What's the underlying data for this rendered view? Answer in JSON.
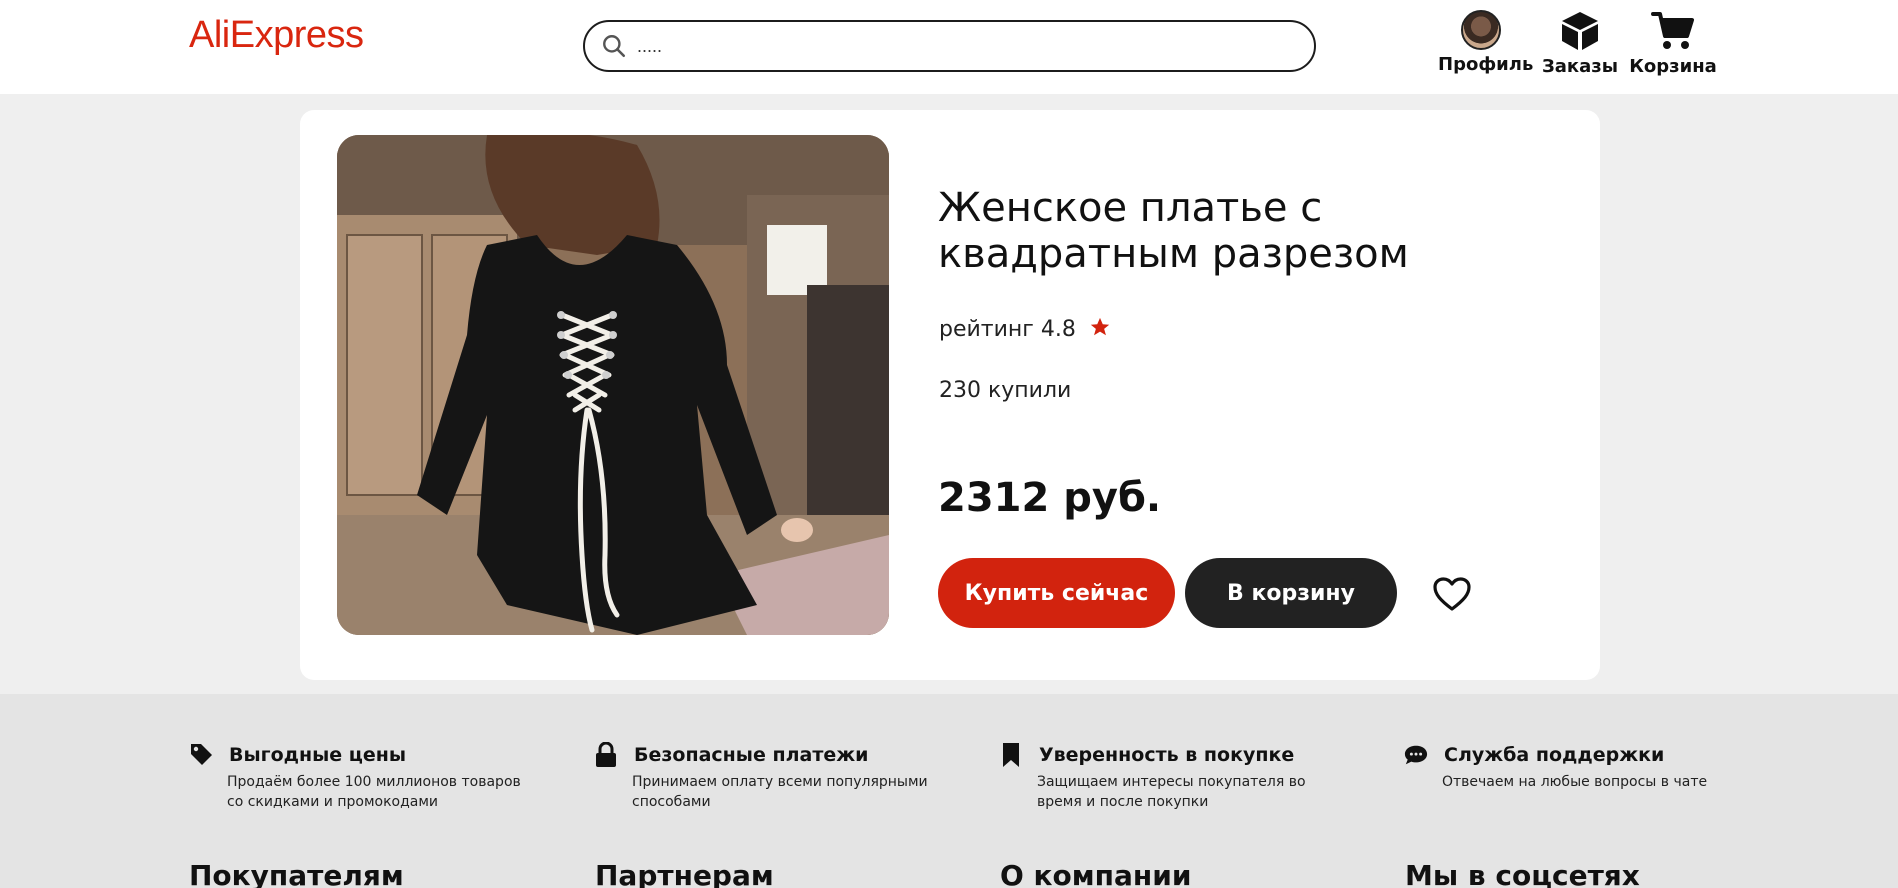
{
  "header": {
    "logo": "AliExpress",
    "search": {
      "placeholder": "....."
    },
    "nav": {
      "profile": "Профиль",
      "orders": "Заказы",
      "cart": "Корзина"
    }
  },
  "product": {
    "title": "Женское платье с квадратным разрезом",
    "rating_label": "рейтинг 4.8",
    "sold": "230 купили",
    "price": "2312 руб.",
    "buy_now": "Купить сейчас",
    "add_to_cart": "В корзину"
  },
  "features": [
    {
      "title": "Выгодные цены",
      "desc": "Продаём более 100 миллионов товаров со скидками и промокодами",
      "icon": "tag-icon"
    },
    {
      "title": "Безопасные платежи",
      "desc": "Принимаем оплату всеми популярными способами",
      "icon": "lock-icon"
    },
    {
      "title": "Уверенность в покупке",
      "desc": "Защищаем интересы покупателя во время и после покупки",
      "icon": "bookmark-icon"
    },
    {
      "title": "Служба поддержки",
      "desc": "Отвечаем на любые вопросы в чате",
      "icon": "chat-icon"
    }
  ],
  "footer_columns": [
    "Покупателям",
    "Партнерам",
    "О компании",
    "Мы в соцсетях"
  ],
  "colors": {
    "brand": "#d2230e",
    "dark_button": "#222222",
    "page_bg": "#efefef",
    "footer_bg": "#e4e4e4"
  }
}
